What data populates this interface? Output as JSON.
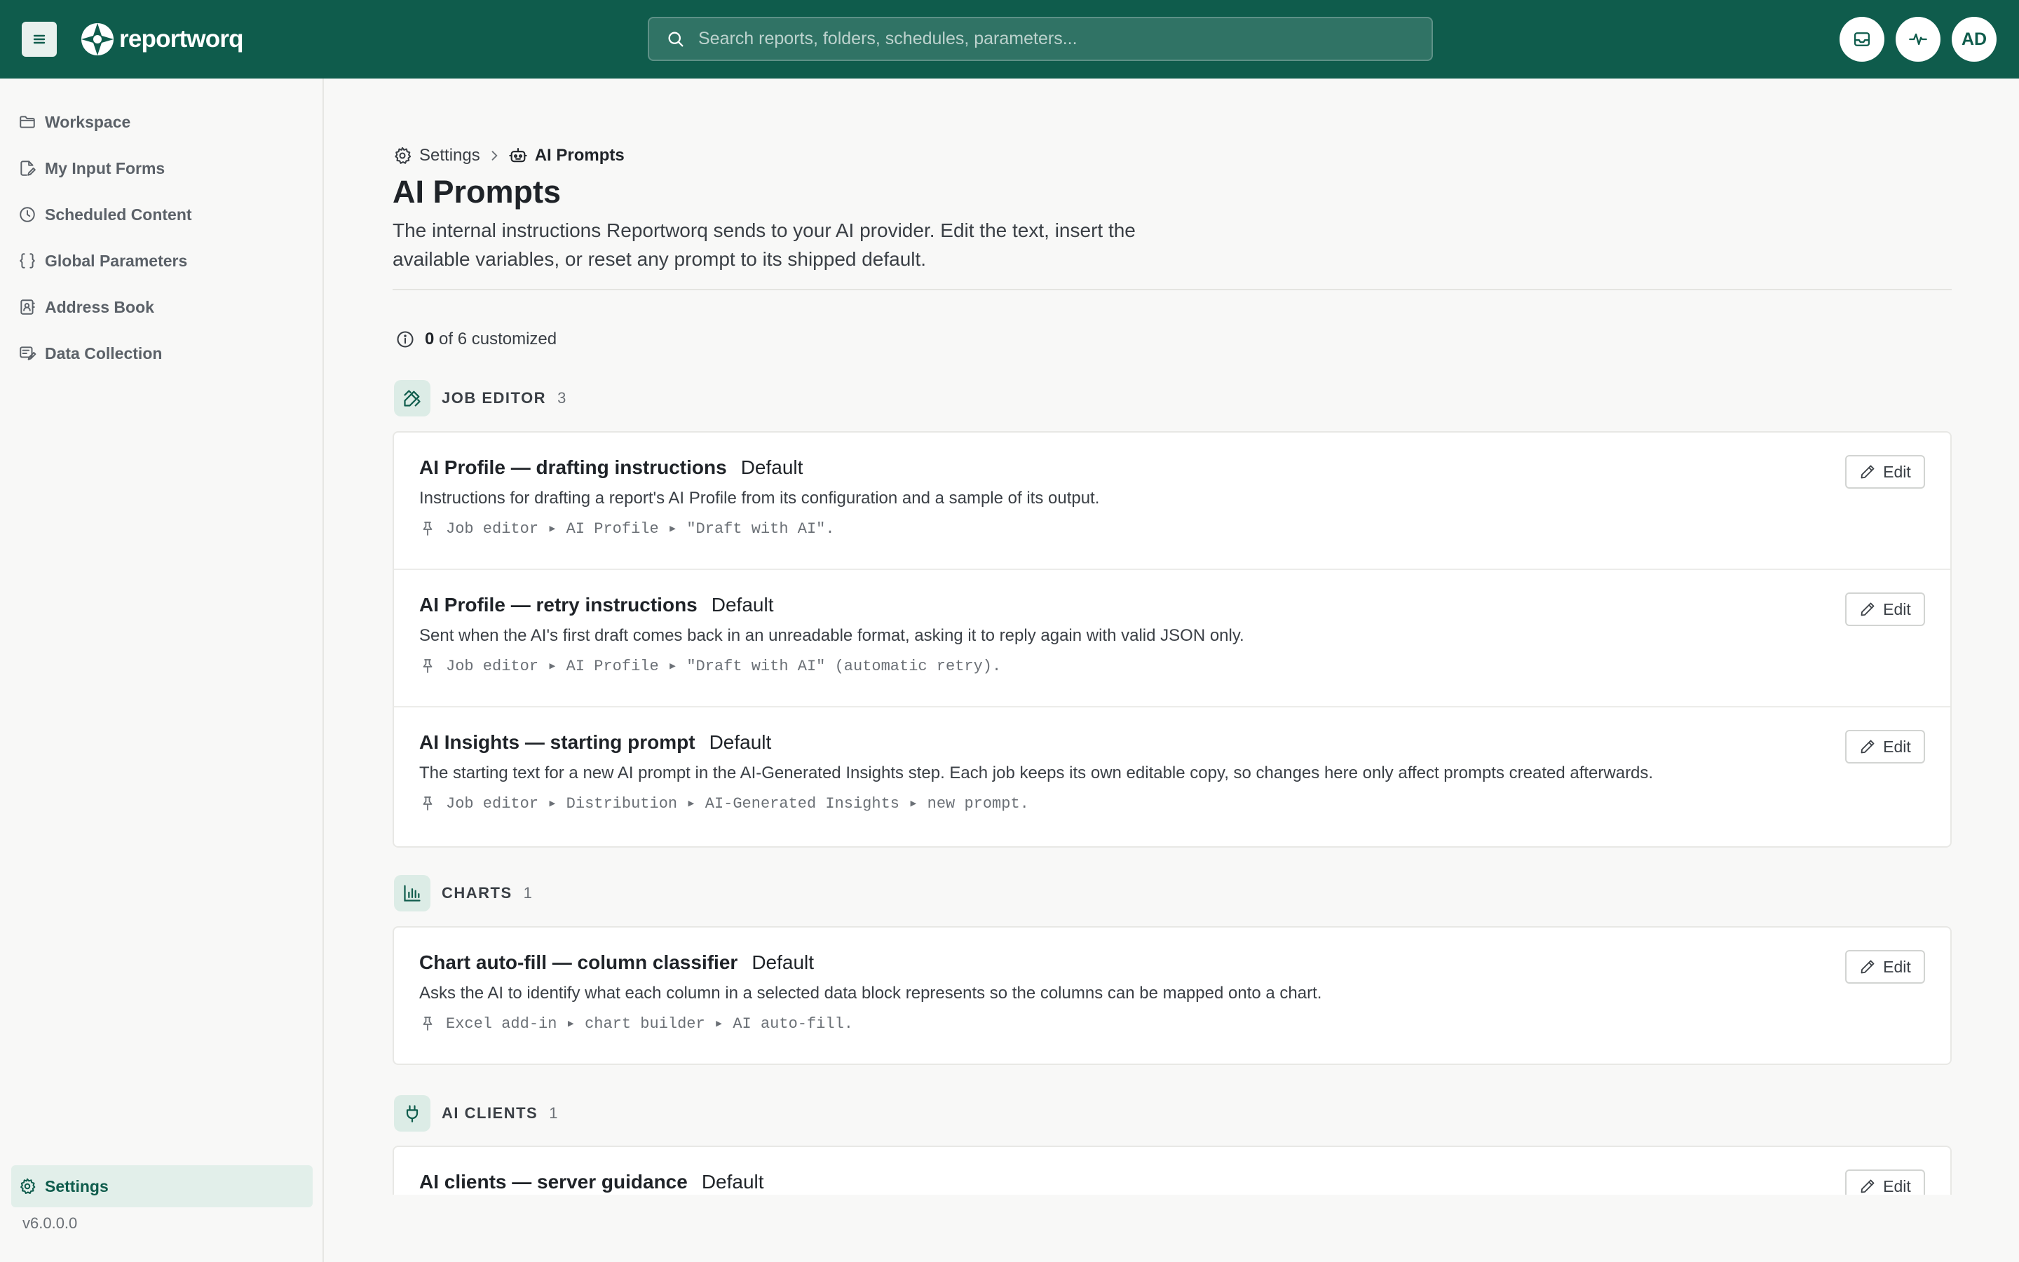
{
  "app": {
    "name": "reportworq",
    "brand_color": "#0f5c4c"
  },
  "search": {
    "placeholder": "Search reports, folders, schedules, parameters..."
  },
  "topbar": {
    "avatar_initials": "AD"
  },
  "sidebar": {
    "items": [
      {
        "label": "Workspace",
        "icon": "folder-icon"
      },
      {
        "label": "My Input Forms",
        "icon": "edit-form-icon"
      },
      {
        "label": "Scheduled Content",
        "icon": "clock-icon"
      },
      {
        "label": "Global Parameters",
        "icon": "braces-icon"
      },
      {
        "label": "Address Book",
        "icon": "contact-book-icon"
      },
      {
        "label": "Data Collection",
        "icon": "form-edit-icon"
      }
    ],
    "settings_label": "Settings",
    "version": "v6.0.0.0"
  },
  "breadcrumb": {
    "root": "Settings",
    "current": "AI Prompts"
  },
  "page": {
    "title": "AI Prompts",
    "description": "The internal instructions Reportworq sends to your AI provider. Edit the text, insert the available variables, or reset any prompt to its shipped default."
  },
  "customized": {
    "count": "0",
    "suffix": "of 6 customized"
  },
  "sections": [
    {
      "title": "JOB EDITOR",
      "count": "3",
      "icon": "pen-ruler-icon",
      "prompts": [
        {
          "name": "AI Profile — drafting instructions",
          "tag": "Default",
          "description": "Instructions for drafting a report's AI Profile from its configuration and a sample of its output.",
          "location": "Job editor ▸ AI Profile ▸ \"Draft with AI\".",
          "edit_label": "Edit"
        },
        {
          "name": "AI Profile — retry instructions",
          "tag": "Default",
          "description": "Sent when the AI's first draft comes back in an unreadable format, asking it to reply again with valid JSON only.",
          "location": "Job editor ▸ AI Profile ▸ \"Draft with AI\" (automatic retry).",
          "edit_label": "Edit"
        },
        {
          "name": "AI Insights — starting prompt",
          "tag": "Default",
          "description": "The starting text for a new AI prompt in the AI-Generated Insights step. Each job keeps its own editable copy, so changes here only affect prompts created afterwards.",
          "location": "Job editor ▸ Distribution ▸ AI-Generated Insights ▸ new prompt.",
          "edit_label": "Edit"
        }
      ]
    },
    {
      "title": "CHARTS",
      "count": "1",
      "icon": "bar-chart-icon",
      "prompts": [
        {
          "name": "Chart auto-fill — column classifier",
          "tag": "Default",
          "description": "Asks the AI to identify what each column in a selected data block represents so the columns can be mapped onto a chart.",
          "location": "Excel add-in ▸ chart builder ▸ AI auto-fill.",
          "edit_label": "Edit"
        }
      ]
    },
    {
      "title": "AI CLIENTS",
      "count": "1",
      "icon": "plug-icon",
      "prompts": [
        {
          "name": "AI clients — server guidance",
          "tag": "Default",
          "edit_label": "Edit"
        }
      ]
    }
  ]
}
